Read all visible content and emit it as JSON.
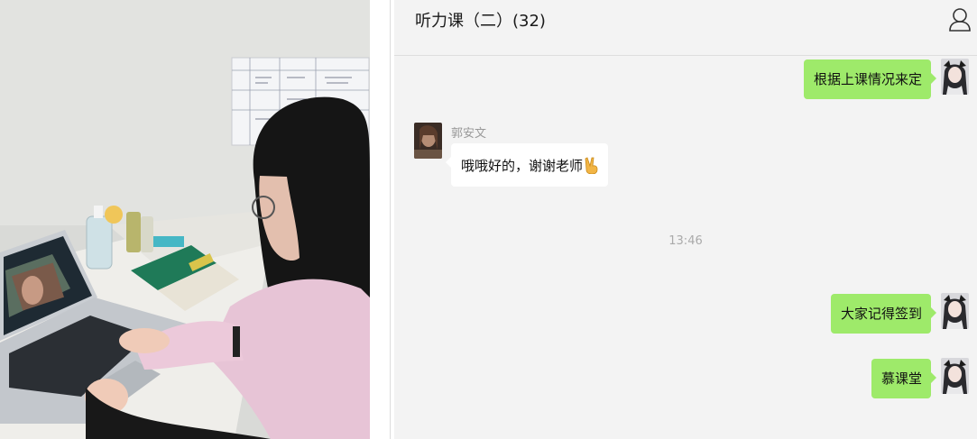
{
  "chat": {
    "title": "听力课（二）(32)",
    "members_icon": "person-outline-icon",
    "messages": [
      {
        "type": "text",
        "side": "right",
        "text": "根据上课情况来定"
      },
      {
        "type": "text",
        "side": "left",
        "sender": "郭安文",
        "text": "哦哦好的，谢谢老师",
        "emoji": "victory-hand-emoji"
      },
      {
        "type": "time",
        "text": "13:46"
      },
      {
        "type": "text",
        "side": "right",
        "text": "大家记得签到"
      },
      {
        "type": "text",
        "side": "right",
        "text": "慕课堂"
      }
    ]
  },
  "colors": {
    "chat_background": "#f3f3f3",
    "my_bubble": "#9eea6a",
    "their_bubble": "#ffffff"
  },
  "photo": {
    "description_icon": "student-at-laptop-photo"
  }
}
